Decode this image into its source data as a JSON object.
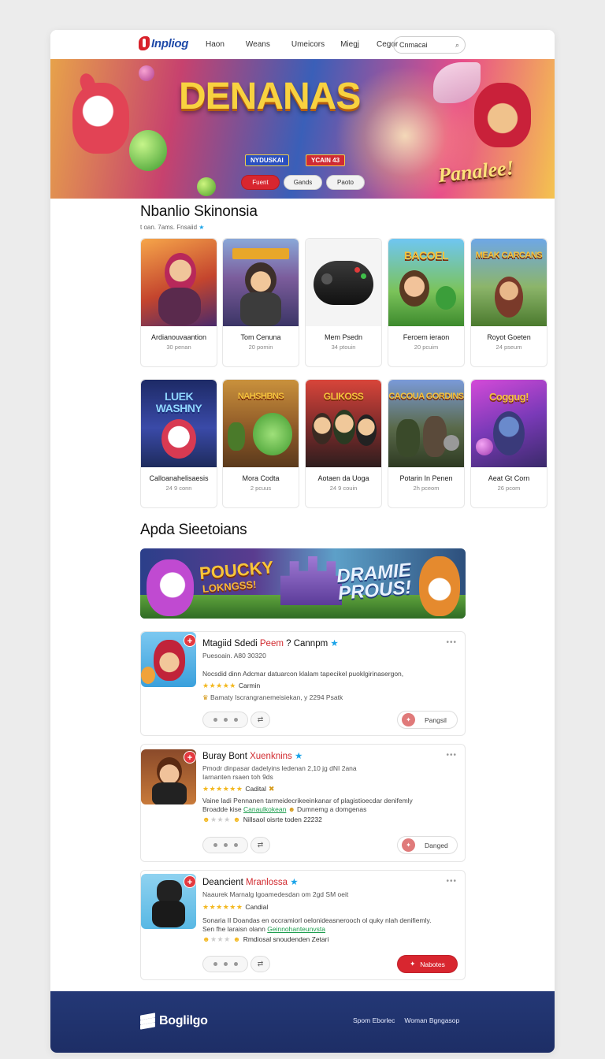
{
  "nav": {
    "logo": "Inpliog",
    "links": [
      "Haon",
      "Weans",
      "Umeicors",
      "Miegj",
      "Cegor"
    ],
    "search_value": "Cnmacai",
    "search_icon": "search-icon"
  },
  "hero": {
    "title": "DENANAS",
    "tag1": "NYDUSKAI",
    "tag2": "YCAIN 43",
    "subtitle": "Panalee!"
  },
  "filters": [
    "Fuent",
    "Gands",
    "Paoto"
  ],
  "section1": {
    "title": "Nbanlio Skinonsia",
    "subtitle": "t oan. 7ams. Fnsaiid"
  },
  "games_row1": [
    {
      "name": "Ardianouvaantion",
      "meta": "30 penan",
      "art": ""
    },
    {
      "name": "Tom Cenuna",
      "meta": "20 pomin",
      "art": ""
    },
    {
      "name": "Mem Psedn",
      "meta": "34 ptouin",
      "art": ""
    },
    {
      "name": "Feroem ieraon",
      "meta": "20 pcuim",
      "art": "BACOEL"
    },
    {
      "name": "Royot Goeten",
      "meta": "24 pseum",
      "art": "MEAK CARCANS"
    }
  ],
  "games_row2": [
    {
      "name": "Calloanahelisaesis",
      "meta": "24 9 conn",
      "art": "LUEK WASHNY"
    },
    {
      "name": "Mora Codta",
      "meta": "2 pcuus",
      "art": "NAHSHBNS"
    },
    {
      "name": "Aotaen da Uoga",
      "meta": "24 9 couin",
      "art": "GLIKOSS"
    },
    {
      "name": "Potarin In Penen",
      "meta": "2h pceom",
      "art": "CACOUA GORDINS"
    },
    {
      "name": "Aeat Gt Corn",
      "meta": "26 pcom",
      "art": "Coggug!"
    }
  ],
  "section2": {
    "title": "Apda Sieetoians"
  },
  "promo": {
    "left": "POUCKY",
    "left_small": "LOKNGSS!",
    "right": "DRAMIE PROUS!"
  },
  "items": [
    {
      "title_a": "Mtagiid Sdedi ",
      "title_b": "Peem",
      "title_c": " ? Cannpm",
      "line1": "Puesoain. A80 30320",
      "desc": "Nocsdid dinn Adcmar datuarcon klalam tapecikel puoklgirinasergon,",
      "stars_label": "Carmin",
      "line3": "Bamaty Iscrangranemeisiekan, y 2294 Psatk",
      "follow": "Pangsil"
    },
    {
      "title_a": "Buray Bont ",
      "title_b": "Xuenknins",
      "line1": "Pmodr dinpasar dadelyins ledenan 2,10 jg dNI 2ana",
      "line1b": "Iarnanten rsaen toh 9ds",
      "stars_label": "Cadital",
      "desc1": "Vaine ladi Pennanen tarmeidecrikeeinkanar of plagistioecdar denifemly",
      "desc2_a": "Broadde kise ",
      "desc2_b": "Canaulkokean",
      "desc2_c": " Dumnemg a domgenas",
      "line4": "Nillsaol oisrte toden 22232",
      "follow": "Danged"
    },
    {
      "title_a": "Deancient ",
      "title_b": "Mranlossa",
      "line1": "Naaurek Marnalg lgoamedesdan om 2gd SM oeit",
      "stars_label": "Candial",
      "desc1": "Sonaria II Doandas en occramiorl oelonideasnerooch ol quky nlah denifiemly.",
      "desc2_a": "Sen fhe laraisn olann ",
      "desc2_b": "Geinnohanteunvsta",
      "line4": "Rmdiosal snoudenden Zetari",
      "follow": "Nabotes"
    }
  ],
  "footer": {
    "name": "Boglilgo",
    "links": [
      "Spom Eborlec",
      "Woman Bgngasop"
    ]
  },
  "colors": {
    "accent": "#d8262f",
    "brand": "#1f4aa8",
    "footer": "#243876"
  }
}
